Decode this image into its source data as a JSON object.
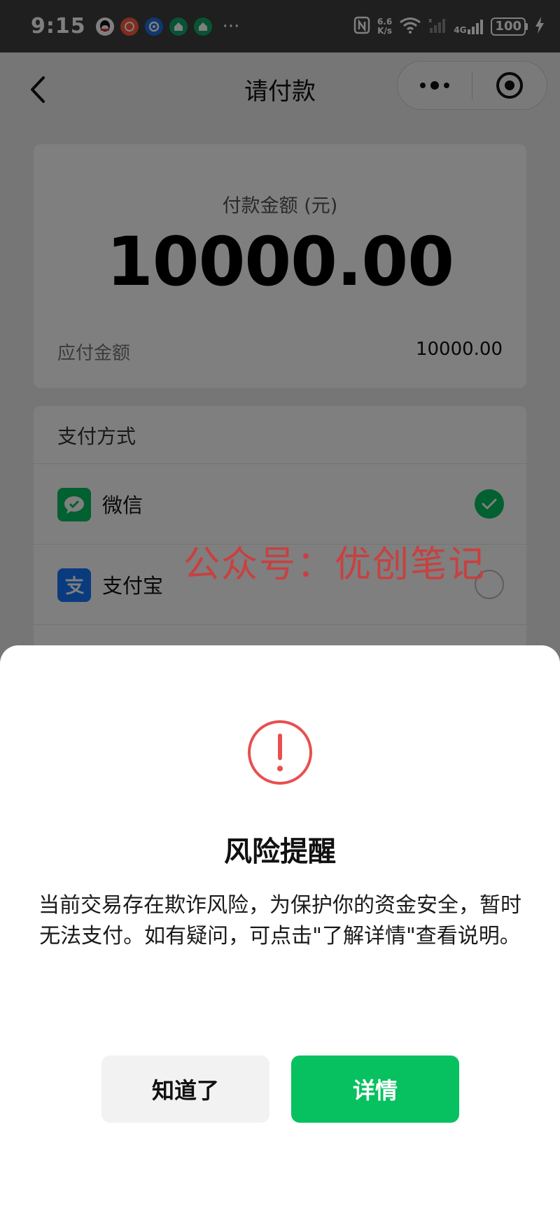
{
  "status_bar": {
    "time": "9:15",
    "net_speed_top": "6.6",
    "net_speed_bottom": "K/s",
    "network_type": "4G",
    "battery": "100",
    "more": "···"
  },
  "nav": {
    "title": "请付款"
  },
  "amount_card": {
    "label": "付款金额 (元)",
    "amount": "10000.00",
    "payable_label": "应付金额",
    "payable_value": "10000.00"
  },
  "payment_methods": {
    "title": "支付方式",
    "items": [
      {
        "name": "微信",
        "selected": true
      },
      {
        "name": "支付宝",
        "selected": false
      }
    ]
  },
  "watermark": "公众号：优创笔记",
  "risk_sheet": {
    "title": "风险提醒",
    "message": "当前交易存在欺诈风险，为保护你的资金安全，暂时无法支付。如有疑问，可点击\"了解详情\"查看说明。",
    "ok_label": "知道了",
    "detail_label": "详情"
  },
  "colors": {
    "wechat_green": "#07c160",
    "alipay_blue": "#1677ff",
    "alert_red": "#e94f4f"
  }
}
